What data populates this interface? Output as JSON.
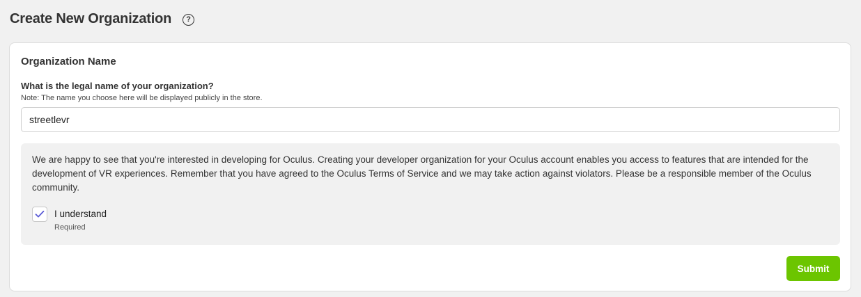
{
  "header": {
    "title": "Create New Organization",
    "help_icon": "question-circle-icon"
  },
  "form": {
    "section_title": "Organization Name",
    "field_label": "What is the legal name of your organization?",
    "field_note": "Note: The name you choose here will be displayed publicly in the store.",
    "name_value": "streetlevr"
  },
  "notice": {
    "text": "We are happy to see that you're interested in developing for Oculus. Creating your developer organization for your Oculus account enables you access to features that are intended for the development of VR experiences. Remember that you have agreed to the Oculus Terms of Service and we may take action against violators. Please be a responsible member of the Oculus community.",
    "checkbox_checked": true,
    "checkbox_label": "I understand",
    "checkbox_sublabel": "Required",
    "check_icon": "checkmark-icon",
    "check_color": "#5b5bd6"
  },
  "actions": {
    "submit_label": "Submit",
    "submit_color": "#6cc500"
  }
}
